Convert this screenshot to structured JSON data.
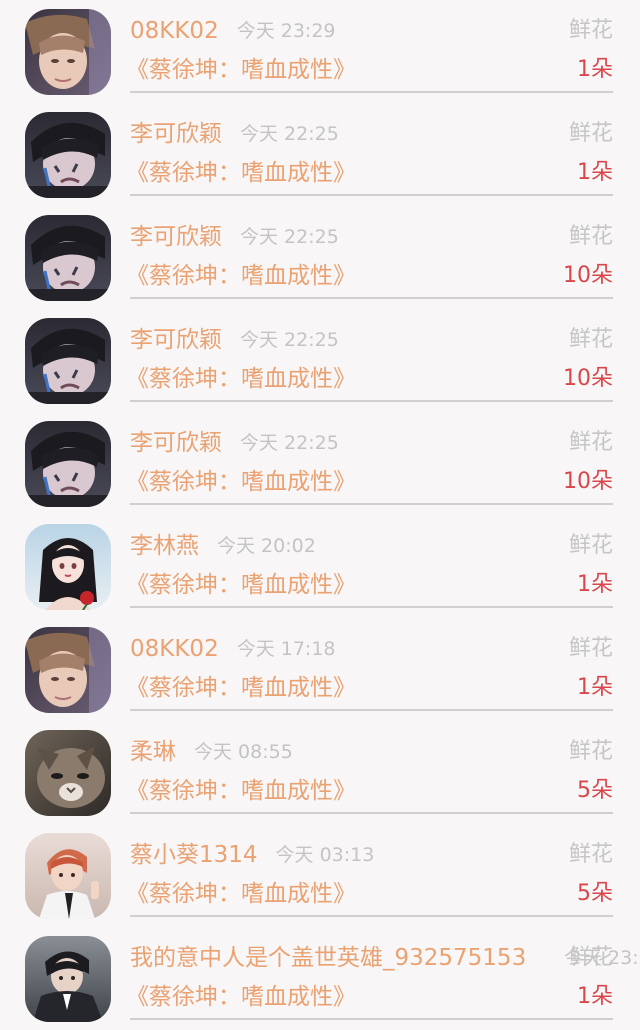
{
  "gift_records": [
    {
      "name": "08KK02",
      "time": "今天 23:29",
      "gift_type": "鲜花",
      "title": "《蔡徐坤：嗜血成性》",
      "quantity": "1朵",
      "avatar": "avatar-blond-selfie"
    },
    {
      "name": "李可欣颖",
      "time": "今天 22:25",
      "gift_type": "鲜花",
      "title": "《蔡徐坤：嗜血成性》",
      "quantity": "1朵",
      "avatar": "avatar-crying-boy"
    },
    {
      "name": "李可欣颖",
      "time": "今天 22:25",
      "gift_type": "鲜花",
      "title": "《蔡徐坤：嗜血成性》",
      "quantity": "10朵",
      "avatar": "avatar-crying-boy"
    },
    {
      "name": "李可欣颖",
      "time": "今天 22:25",
      "gift_type": "鲜花",
      "title": "《蔡徐坤：嗜血成性》",
      "quantity": "10朵",
      "avatar": "avatar-crying-boy"
    },
    {
      "name": "李可欣颖",
      "time": "今天 22:25",
      "gift_type": "鲜花",
      "title": "《蔡徐坤：嗜血成性》",
      "quantity": "10朵",
      "avatar": "avatar-crying-boy"
    },
    {
      "name": "李林燕",
      "time": "今天 20:02",
      "gift_type": "鲜花",
      "title": "《蔡徐坤：嗜血成性》",
      "quantity": "1朵",
      "avatar": "avatar-anime-girl-rose"
    },
    {
      "name": "08KK02",
      "time": "今天 17:18",
      "gift_type": "鲜花",
      "title": "《蔡徐坤：嗜血成性》",
      "quantity": "1朵",
      "avatar": "avatar-blond-selfie"
    },
    {
      "name": "柔琳",
      "time": "今天 08:55",
      "gift_type": "鲜花",
      "title": "《蔡徐坤：嗜血成性》",
      "quantity": "5朵",
      "avatar": "avatar-cat"
    },
    {
      "name": "蔡小葵1314",
      "time": "今天 03:13",
      "gift_type": "鲜花",
      "title": "《蔡徐坤：嗜血成性》",
      "quantity": "5朵",
      "avatar": "avatar-pink-hair-boy"
    },
    {
      "name": "我的意中人是个盖世英雄_932575153",
      "time": "今天 23:",
      "gift_type": "鲜花",
      "title": "《蔡徐坤：嗜血成性》",
      "quantity": "1朵",
      "avatar": "avatar-boy-in-suit"
    }
  ],
  "colors": {
    "background": "#f8f6f6",
    "name_text": "#eaa272",
    "muted_text": "#c4c4c4",
    "quantity_text": "#d8474c",
    "divider": "#d0d0d0"
  }
}
